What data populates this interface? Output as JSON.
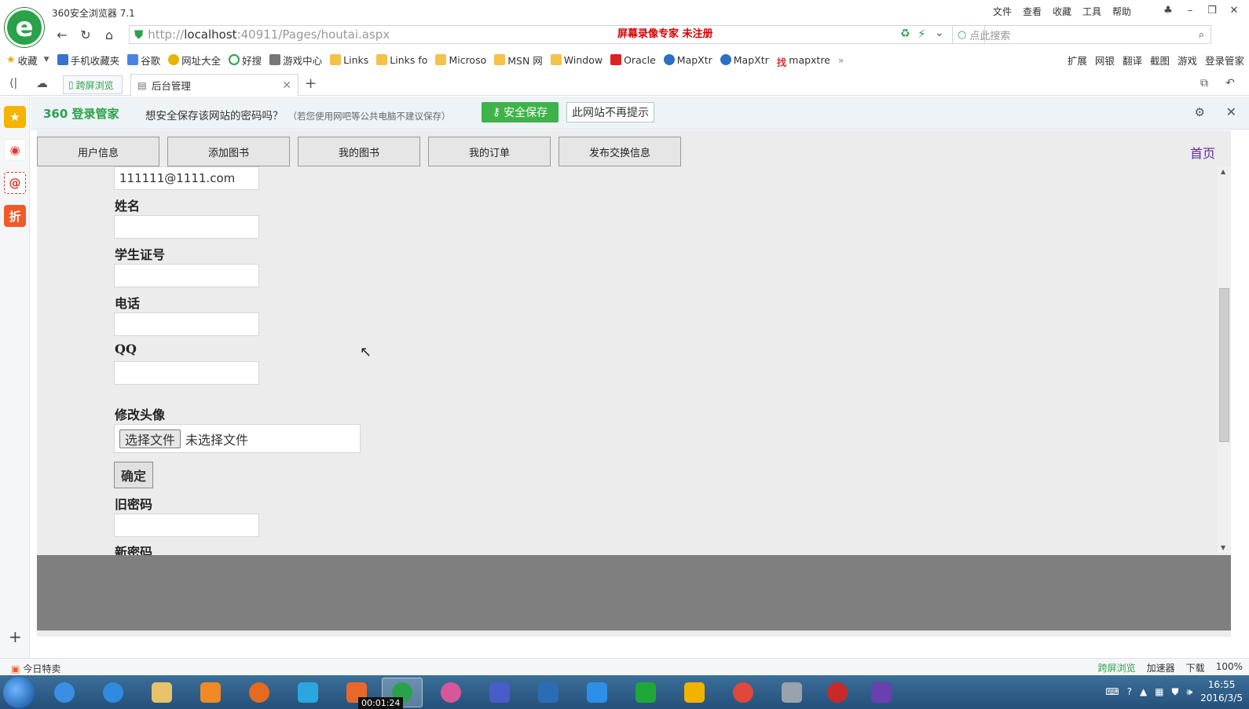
{
  "browser": {
    "title": "360安全浏览器 7.1",
    "menus": [
      "文件",
      "查看",
      "收藏",
      "工具",
      "帮助"
    ],
    "url_scheme_prefix": "http://",
    "url_host": "localhost",
    "url_rest": ":40911/Pages/houtai.aspx",
    "recording_watermark": "屏幕录像专家  未注册",
    "search_placeholder": "点此搜索"
  },
  "bookmarks": {
    "items": [
      {
        "label": "收藏",
        "icon": "star-icon"
      },
      {
        "label": "手机收藏夹",
        "icon": "phone-icon"
      },
      {
        "label": "谷歌",
        "icon": "google-icon"
      },
      {
        "label": "网址大全",
        "icon": "sites-icon"
      },
      {
        "label": "好搜",
        "icon": "haosou-icon"
      },
      {
        "label": "游戏中心",
        "icon": "game-icon"
      },
      {
        "label": "Links",
        "icon": "folder-icon"
      },
      {
        "label": "Links fo",
        "icon": "folder-icon"
      },
      {
        "label": "Microso",
        "icon": "folder-icon"
      },
      {
        "label": "MSN 网",
        "icon": "folder-icon"
      },
      {
        "label": "Window",
        "icon": "folder-icon"
      },
      {
        "label": "Oracle",
        "icon": "oracle-icon"
      },
      {
        "label": "MapXtr",
        "icon": "mapx-icon"
      },
      {
        "label": "MapXtr",
        "icon": "mapx-icon"
      },
      {
        "label": "mapxtre",
        "icon": "find-icon"
      }
    ],
    "right": [
      "扩展",
      "网银",
      "翻译",
      "截图",
      "游戏",
      "登录管家"
    ]
  },
  "tabs": {
    "split_label": "跨屏浏览",
    "active_label": "后台管理"
  },
  "password_bar": {
    "brand": "360 登录管家",
    "message": "想安全保存该网站的密码吗？",
    "note": "（若您使用网吧等公共电脑不建议保存）",
    "save_label": "安全保存",
    "never_label": "此网站不再提示"
  },
  "page": {
    "nav": [
      "用户信息",
      "添加图书",
      "我的图书",
      "我的订单",
      "发布交换信息"
    ],
    "home_link": "首页",
    "email_value": "111111@1111.com",
    "labels": {
      "name": "姓名",
      "student_id": "学生证号",
      "phone": "电话",
      "qq": "QQ",
      "avatar": "修改头像",
      "old_password": "旧密码",
      "new_password": "新密码"
    },
    "file_button": "选择文件",
    "file_status": "未选择文件",
    "confirm": "确定"
  },
  "statusbar": {
    "left": "今日特卖",
    "right": [
      "跨屏浏览",
      "加速器",
      "下载",
      "100%"
    ]
  },
  "taskbar": {
    "recording_time": "00:01:24",
    "time": "16:55",
    "date": "2016/3/5"
  }
}
